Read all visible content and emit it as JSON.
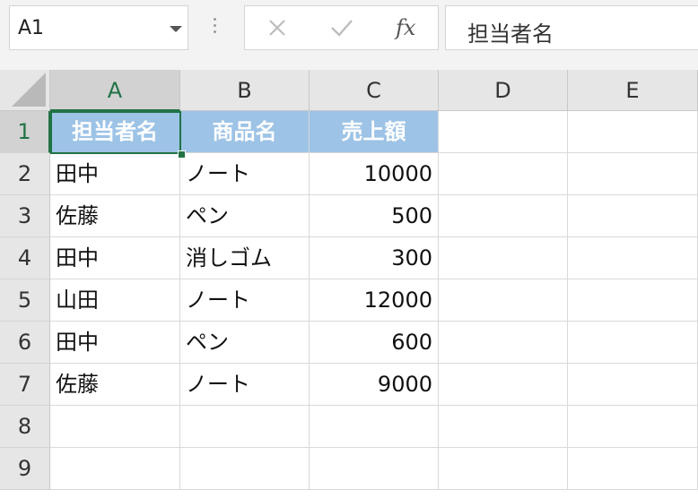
{
  "name_box": {
    "value": "A1"
  },
  "formula_bar": {
    "fx_label": "fx",
    "value": "担当者名"
  },
  "columns": [
    "A",
    "B",
    "C",
    "D",
    "E"
  ],
  "rows": [
    "1",
    "2",
    "3",
    "4",
    "5",
    "6",
    "7",
    "8",
    "9"
  ],
  "table": {
    "headers": [
      "担当者名",
      "商品名",
      "売上額"
    ],
    "data": [
      [
        "田中",
        "ノート",
        "10000"
      ],
      [
        "佐藤",
        "ペン",
        "500"
      ],
      [
        "田中",
        "消しゴム",
        "300"
      ],
      [
        "山田",
        "ノート",
        "12000"
      ],
      [
        "田中",
        "ペン",
        "600"
      ],
      [
        "佐藤",
        "ノート",
        "9000"
      ]
    ]
  },
  "colors": {
    "header_fill": "#9dc3e6",
    "selection_border": "#217346",
    "gridline": "#d9d9d9"
  }
}
